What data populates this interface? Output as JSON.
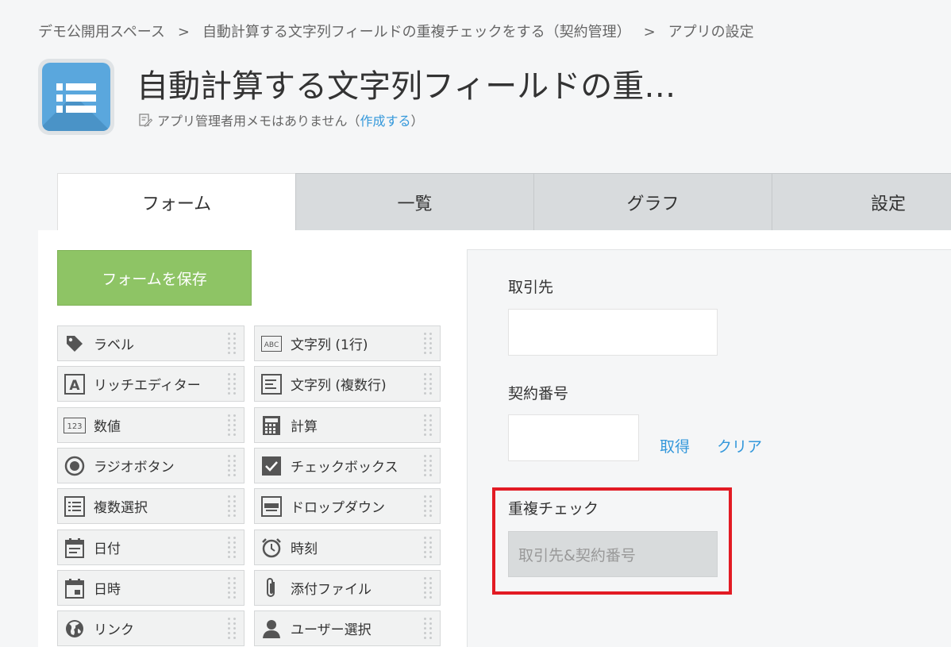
{
  "breadcrumb": {
    "space": "デモ公開用スペース",
    "app": "自動計算する文字列フィールドの重複チェックをする（契約管理）",
    "page": "アプリの設定",
    "separator": ">"
  },
  "app": {
    "title": "自動計算する文字列フィールドの重…",
    "memo_text": "アプリ管理者用メモはありません（",
    "memo_link": "作成する",
    "memo_end": "）",
    "icon_color": "#5aa7dd"
  },
  "tabs": [
    {
      "label": "フォーム",
      "active": true
    },
    {
      "label": "一覧"
    },
    {
      "label": "グラフ"
    },
    {
      "label": "設定"
    }
  ],
  "save_button": "フォームを保存",
  "palette": [
    {
      "label": "ラベル",
      "icon": "tag-icon"
    },
    {
      "label": "文字列 (1行)",
      "icon": "abc-icon"
    },
    {
      "label": "リッチエディター",
      "icon": "rich-editor-icon"
    },
    {
      "label": "文字列 (複数行)",
      "icon": "multiline-text-icon"
    },
    {
      "label": "数値",
      "icon": "number-icon",
      "glyph": "123"
    },
    {
      "label": "計算",
      "icon": "calculator-icon"
    },
    {
      "label": "ラジオボタン",
      "icon": "radio-icon"
    },
    {
      "label": "チェックボックス",
      "icon": "checkbox-icon"
    },
    {
      "label": "複数選択",
      "icon": "multi-select-icon"
    },
    {
      "label": "ドロップダウン",
      "icon": "dropdown-icon"
    },
    {
      "label": "日付",
      "icon": "date-icon"
    },
    {
      "label": "時刻",
      "icon": "clock-icon"
    },
    {
      "label": "日時",
      "icon": "datetime-icon"
    },
    {
      "label": "添付ファイル",
      "icon": "paperclip-icon"
    },
    {
      "label": "リンク",
      "icon": "globe-icon"
    },
    {
      "label": "ユーザー選択",
      "icon": "user-icon"
    }
  ],
  "form": {
    "field1_label": "取引先",
    "field2_label": "契約番号",
    "lookup_get": "取得",
    "lookup_clear": "クリア",
    "field3_label": "重複チェック",
    "field3_value": "取引先&契約番号"
  },
  "colors": {
    "accent": "#3498db",
    "save_button": "#8ec465",
    "highlight": "#e21b24"
  }
}
